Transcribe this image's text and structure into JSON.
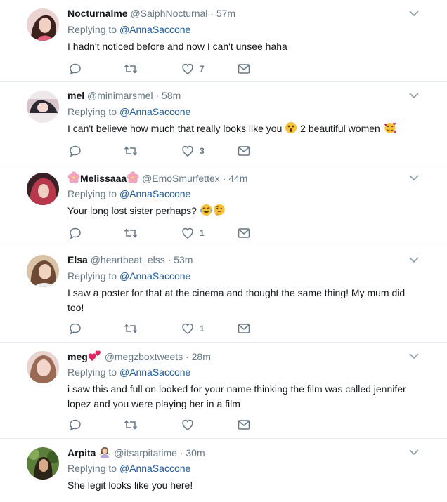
{
  "colors": {
    "link": "#1b5c9e",
    "secondary": "#657786",
    "divider": "#e6ecf0",
    "text": "#14171a"
  },
  "tweets": [
    {
      "name": "Nocturnalme",
      "handle": "@SaiphNocturnal",
      "separator": "·",
      "time": "57m",
      "reply_prefix": "Replying to",
      "reply_to": "@AnnaSaccone",
      "text": "I hadn't noticed before and now I can't unsee haha",
      "likes": "7",
      "avatar_colors": [
        "#e8c6c6",
        "#4a2a24"
      ]
    },
    {
      "name": "mel",
      "handle": "@minimarsmel",
      "separator": "·",
      "time": "58m",
      "reply_prefix": "Replying to",
      "reply_to": "@AnnaSaccone",
      "text_parts": [
        "I can't believe how much that really looks like you",
        "2 beautiful women"
      ],
      "text_emojis": [
        "astonished-face-icon",
        "smiling-face-with-hearts-icon"
      ],
      "likes": "3",
      "avatar_colors": [
        "#d9cfd3",
        "#2c2a36"
      ]
    },
    {
      "name_prefix_emoji": "cherry-blossom-icon",
      "name": "Melissaaa",
      "name_suffix_emoji": "cherry-blossom-icon",
      "handle": "@EmoSmurfettex",
      "separator": "·",
      "time": "44m",
      "reply_prefix": "Replying to",
      "reply_to": "@AnnaSaccone",
      "text": "Your long lost sister perhaps?",
      "text_emojis": [
        "face-with-tears-of-joy-icon",
        "thinking-face-icon"
      ],
      "likes": "1",
      "avatar_colors": [
        "#b5364a",
        "#2a1416"
      ]
    },
    {
      "name": "Elsa",
      "handle": "@heartbeat_elss",
      "separator": "·",
      "time": "53m",
      "reply_prefix": "Replying to",
      "reply_to": "@AnnaSaccone",
      "text": "I saw a poster for that at the cinema and thought the same thing! My mum did too!",
      "likes": "1",
      "avatar_colors": [
        "#e3c7a8",
        "#6b4a35"
      ]
    },
    {
      "name": "meg",
      "name_suffix_emoji": "two-hearts-icon",
      "handle": "@megzboxtweets",
      "separator": "·",
      "time": "28m",
      "reply_prefix": "Replying to",
      "reply_to": "@AnnaSaccone",
      "text": "i saw this and full on looked for your name thinking the film was called jennifer lopez and you were playing her in a film",
      "likes": "",
      "avatar_colors": [
        "#e7c9c2",
        "#8a5a48"
      ]
    },
    {
      "name": "Arpita",
      "name_suffix_emoji": "woman-shrugging-icon",
      "handle": "@itsarpitatime",
      "separator": "·",
      "time": "30m",
      "reply_prefix": "Replying to",
      "reply_to": "@AnnaSaccone",
      "text": "She legit looks like you here!",
      "likes": "",
      "avatar_colors": [
        "#5b7d3a",
        "#2a2a1c"
      ]
    }
  ],
  "icons": {
    "reply": "reply-icon",
    "retweet": "retweet-icon",
    "like": "heart-icon",
    "dm": "envelope-icon",
    "menu": "chevron-down-icon"
  }
}
